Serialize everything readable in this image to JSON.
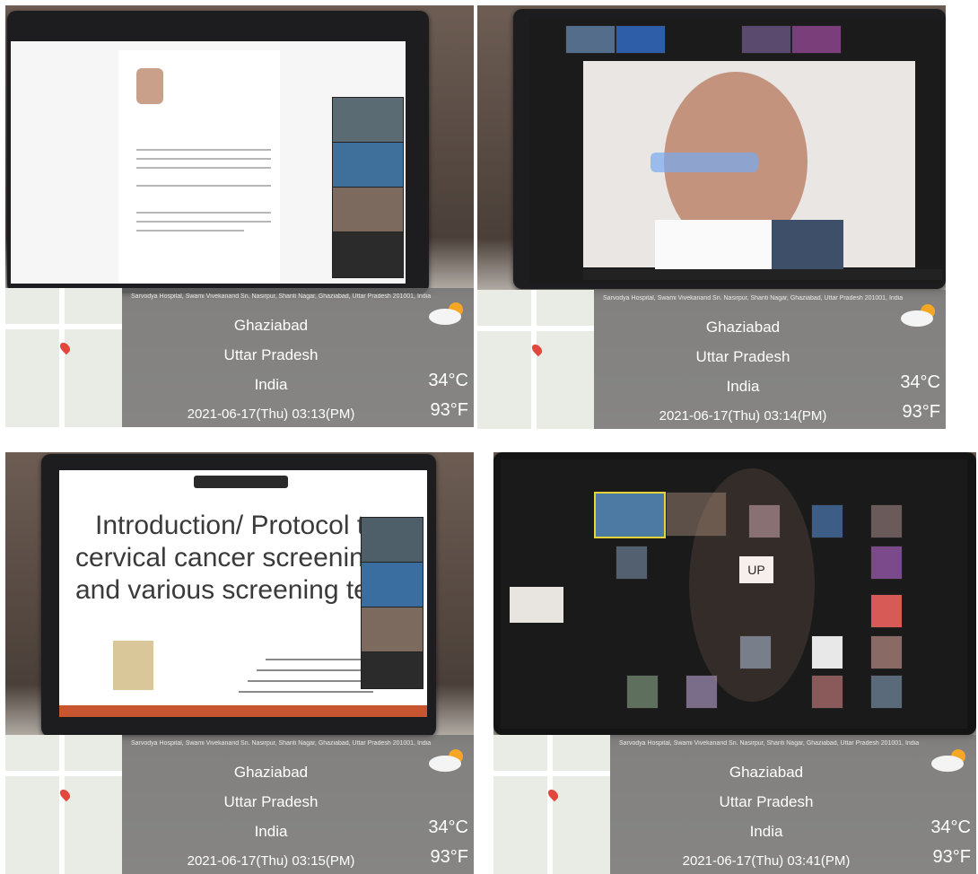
{
  "photos": [
    {
      "address": "Sarvodya Hospital, Swami Vivekanand Sn. Nasirpur, Shanti Nagar, Ghaziabad, Uttar Pradesh 201001, India",
      "city": "Ghaziabad",
      "state": "Uttar Pradesh",
      "country": "India",
      "datetime": "2021-06-17(Thu)  03:13(PM)",
      "temp_c": "34°C",
      "temp_f": "93°F"
    },
    {
      "address": "Sarvodya Hospital, Swami Vivekanand Sn. Nasirpur, Shanti Nagar, Ghaziabad, Uttar Pradesh 201001, India",
      "city": "Ghaziabad",
      "state": "Uttar Pradesh",
      "country": "India",
      "datetime": "2021-06-17(Thu)  03:14(PM)",
      "temp_c": "34°C",
      "temp_f": "93°F"
    },
    {
      "address": "Sarvodya Hospital, Swami Vivekanand Sn. Nasirpur, Shanti Nagar, Ghaziabad, Uttar Pradesh 201001, India",
      "city": "Ghaziabad",
      "state": "Uttar Pradesh",
      "country": "India",
      "datetime": "2021-06-17(Thu)  03:15(PM)",
      "temp_c": "34°C",
      "temp_f": "93°F",
      "slide_line1": "Introduction/ Protocol to",
      "slide_line2": "cervical cancer screening",
      "slide_line3": "and various screening tes"
    },
    {
      "address": "Sarvodya Hospital, Swami Vivekanand Sn. Nasirpur, Shanti Nagar, Ghaziabad, Uttar Pradesh 201001, India",
      "city": "Ghaziabad",
      "state": "Uttar Pradesh",
      "country": "India",
      "datetime": "2021-06-17(Thu)  03:41(PM)",
      "temp_c": "34°C",
      "temp_f": "93°F",
      "tile_label": "UP"
    }
  ],
  "colors": {
    "overlay": "#6e6e6e",
    "laptop": "#1d1d1f",
    "slide_bg": "#ffffff",
    "zoom_bg": "#1a1a1a"
  },
  "icons": [
    "cloud-sun-icon",
    "map-pin-icon"
  ]
}
